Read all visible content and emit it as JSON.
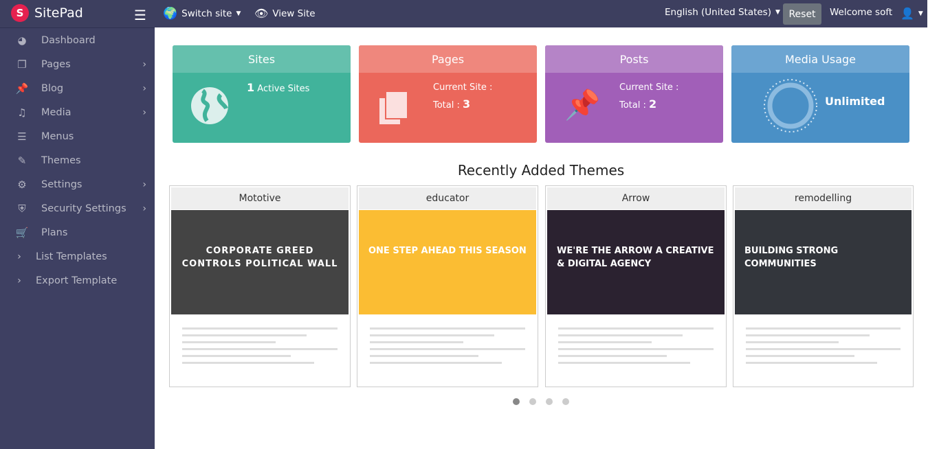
{
  "app": {
    "name": "SitePad"
  },
  "topbar": {
    "switch_site": "Switch site",
    "view_site": "View Site",
    "language": "English (United States)",
    "reset": "Reset",
    "welcome": "Welcome soft"
  },
  "sidebar": {
    "items": [
      {
        "label": "Dashboard",
        "icon": "dashboard-icon",
        "glyph": "◕",
        "sub": false
      },
      {
        "label": "Pages",
        "icon": "pages-icon",
        "glyph": "❐",
        "sub": true
      },
      {
        "label": "Blog",
        "icon": "pin-icon",
        "glyph": "📌",
        "sub": true
      },
      {
        "label": "Media",
        "icon": "media-icon",
        "glyph": "♫",
        "sub": true
      },
      {
        "label": "Menus",
        "icon": "menu-list-icon",
        "glyph": "☰",
        "sub": false
      },
      {
        "label": "Themes",
        "icon": "brush-icon",
        "glyph": "✎",
        "sub": false
      },
      {
        "label": "Settings",
        "icon": "settings-icon",
        "glyph": "⚙",
        "sub": true
      },
      {
        "label": "Security Settings",
        "icon": "shield-icon",
        "glyph": "⛨",
        "sub": true
      },
      {
        "label": "Plans",
        "icon": "cart-icon",
        "glyph": "🛒",
        "sub": false
      },
      {
        "label": "List Templates",
        "icon": "chevron-right-icon",
        "glyph": "›",
        "sub": false
      },
      {
        "label": "Export Template",
        "icon": "chevron-right-icon",
        "glyph": "›",
        "sub": false
      }
    ]
  },
  "cards": {
    "sites": {
      "title": "Sites",
      "count": "1",
      "label": "Active Sites",
      "color": "#41b39b",
      "header": "#65c0ad"
    },
    "pages": {
      "title": "Pages",
      "current": "Current Site :",
      "total_label": "Total :",
      "total": "3",
      "color": "#eb675b",
      "header": "#ef877d"
    },
    "posts": {
      "title": "Posts",
      "current": "Current Site :",
      "total_label": "Total :",
      "total": "2",
      "color": "#a15fb8",
      "header": "#b584c7"
    },
    "media": {
      "title": "Media Usage",
      "value": "Unlimited",
      "color": "#4a90c6",
      "header": "#6ca5d2"
    }
  },
  "themes": {
    "title": "Recently Added Themes",
    "items": [
      {
        "name": "Mototive",
        "headline": "CORPORATE GREED CONTROLS POLITICAL WALL",
        "bg": "#444"
      },
      {
        "name": "educator",
        "headline": "ONE STEP AHEAD THIS SEASON",
        "bg": "#fbbd33"
      },
      {
        "name": "Arrow",
        "headline": "WE'RE THE ARROW A CREATIVE & DIGITAL AGENCY",
        "bg": "#2b2230"
      },
      {
        "name": "remodelling",
        "headline": "BUILDING STRONG COMMUNITIES",
        "bg": "#33363c"
      }
    ]
  },
  "slider": {
    "pages": 4,
    "active": 1
  }
}
